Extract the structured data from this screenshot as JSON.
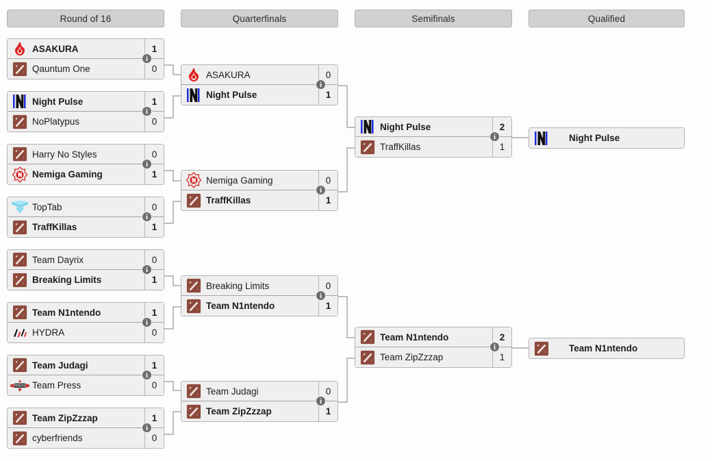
{
  "page": {
    "title": "Tournament Bracket",
    "background": "#fdfdfd",
    "line_color": "#bdbdbd",
    "header_bg": "#d1d1d1",
    "box_bg": "#efefef",
    "info_badge_label": "i"
  },
  "rounds": [
    {
      "id": "round-of-16",
      "label": "Round of 16"
    },
    {
      "id": "quarterfinals",
      "label": "Quarterfinals"
    },
    {
      "id": "semifinals",
      "label": "Semifinals"
    },
    {
      "id": "qualified",
      "label": "Qualified"
    }
  ],
  "matches": {
    "r16_m1": {
      "top": {
        "team": "ASAKURA",
        "score": "1",
        "winner": true,
        "logo": "asakura-logo"
      },
      "bottom": {
        "team": "Qauntum One",
        "score": "0",
        "winner": false,
        "logo": "dota-default-logo"
      }
    },
    "r16_m2": {
      "top": {
        "team": "Night Pulse",
        "score": "1",
        "winner": true,
        "logo": "night-pulse-logo"
      },
      "bottom": {
        "team": "NoPlatypus",
        "score": "0",
        "winner": false,
        "logo": "dota-default-logo"
      }
    },
    "r16_m3": {
      "top": {
        "team": "Harry No Styles",
        "score": "0",
        "winner": false,
        "logo": "dota-default-logo"
      },
      "bottom": {
        "team": "Nemiga Gaming",
        "score": "1",
        "winner": true,
        "logo": "nemiga-logo"
      }
    },
    "r16_m4": {
      "top": {
        "team": "TopTab",
        "score": "0",
        "winner": false,
        "logo": "toptab-logo"
      },
      "bottom": {
        "team": "TraffKillas",
        "score": "1",
        "winner": true,
        "logo": "dota-default-logo"
      }
    },
    "r16_m5": {
      "top": {
        "team": "Team Dayrix",
        "score": "0",
        "winner": false,
        "logo": "dota-default-logo"
      },
      "bottom": {
        "team": "Breaking Limits",
        "score": "1",
        "winner": true,
        "logo": "dota-default-logo"
      }
    },
    "r16_m6": {
      "top": {
        "team": "Team N1ntendo",
        "score": "1",
        "winner": true,
        "logo": "dota-default-logo"
      },
      "bottom": {
        "team": "HYDRA",
        "score": "0",
        "winner": false,
        "logo": "hydra-logo"
      }
    },
    "r16_m7": {
      "top": {
        "team": "Team Judagi",
        "score": "1",
        "winner": true,
        "logo": "dota-default-logo"
      },
      "bottom": {
        "team": "Team Press",
        "score": "0",
        "winner": false,
        "logo": "team-press-logo"
      }
    },
    "r16_m8": {
      "top": {
        "team": "Team ZipZzzap",
        "score": "1",
        "winner": true,
        "logo": "dota-default-logo"
      },
      "bottom": {
        "team": "cyberfriends",
        "score": "0",
        "winner": false,
        "logo": "dota-default-logo"
      }
    },
    "qf_m1": {
      "top": {
        "team": "ASAKURA",
        "score": "0",
        "winner": false,
        "logo": "asakura-logo"
      },
      "bottom": {
        "team": "Night Pulse",
        "score": "1",
        "winner": true,
        "logo": "night-pulse-logo"
      }
    },
    "qf_m2": {
      "top": {
        "team": "Nemiga Gaming",
        "score": "0",
        "winner": false,
        "logo": "nemiga-logo"
      },
      "bottom": {
        "team": "TraffKillas",
        "score": "1",
        "winner": true,
        "logo": "dota-default-logo"
      }
    },
    "qf_m3": {
      "top": {
        "team": "Breaking Limits",
        "score": "0",
        "winner": false,
        "logo": "dota-default-logo"
      },
      "bottom": {
        "team": "Team N1ntendo",
        "score": "1",
        "winner": true,
        "logo": "dota-default-logo"
      }
    },
    "qf_m4": {
      "top": {
        "team": "Team Judagi",
        "score": "0",
        "winner": false,
        "logo": "dota-default-logo"
      },
      "bottom": {
        "team": "Team ZipZzzap",
        "score": "1",
        "winner": true,
        "logo": "dota-default-logo"
      }
    },
    "sf_m1": {
      "top": {
        "team": "Night Pulse",
        "score": "2",
        "winner": true,
        "logo": "night-pulse-logo"
      },
      "bottom": {
        "team": "TraffKillas",
        "score": "1",
        "winner": false,
        "logo": "dota-default-logo"
      }
    },
    "sf_m2": {
      "top": {
        "team": "Team N1ntendo",
        "score": "2",
        "winner": true,
        "logo": "dota-default-logo"
      },
      "bottom": {
        "team": "Team ZipZzzap",
        "score": "1",
        "winner": false,
        "logo": "dota-default-logo"
      }
    },
    "q_m1": {
      "top": {
        "team": "Night Pulse",
        "score": "",
        "winner": true,
        "logo": "night-pulse-logo"
      }
    },
    "q_m2": {
      "top": {
        "team": "Team N1ntendo",
        "score": "",
        "winner": true,
        "logo": "dota-default-logo"
      }
    }
  }
}
